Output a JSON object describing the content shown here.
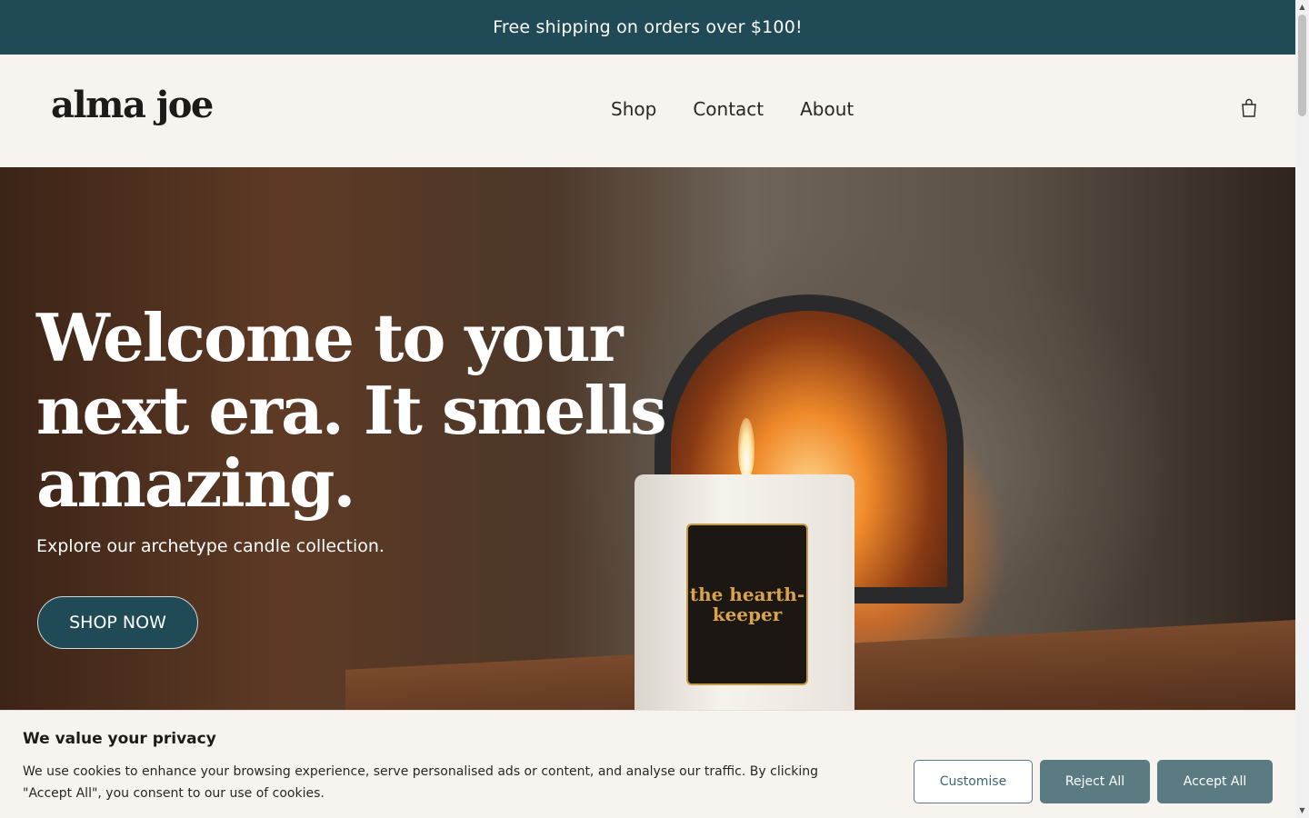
{
  "announcement": {
    "text": "Free shipping on orders over $100!"
  },
  "header": {
    "logo": "alma joe",
    "nav": [
      {
        "label": "Shop"
      },
      {
        "label": "Contact"
      },
      {
        "label": "About"
      }
    ],
    "cart_icon": "shopping-bag-icon"
  },
  "hero": {
    "title": "Welcome to your next era. It smells amazing.",
    "subtitle": "Explore our archetype candle collection.",
    "cta_label": "SHOP NOW",
    "candle_label": "the hearth-keeper"
  },
  "cookie_banner": {
    "title": "We value your privacy",
    "text": "We use cookies to enhance your browsing experience, serve personalised ads or content, and analyse our traffic. By clicking \"Accept All\", you consent to our use of cookies.",
    "buttons": {
      "customise": "Customise",
      "reject": "Reject All",
      "accept": "Accept All"
    }
  },
  "colors": {
    "brand_teal": "#1f4a56",
    "cookie_button": "#5b7b83",
    "background": "#f7f4f0"
  }
}
